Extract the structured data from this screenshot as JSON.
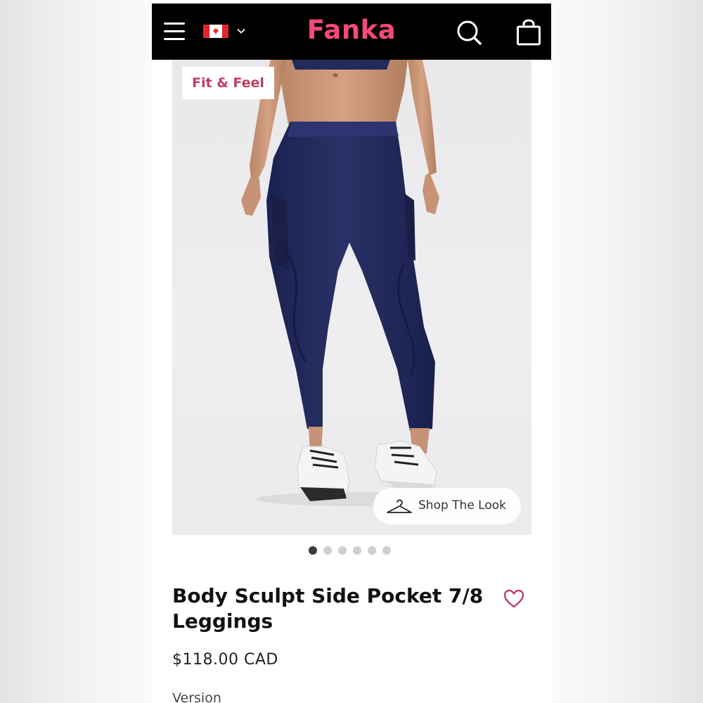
{
  "header": {
    "brand": "Fanka",
    "menu_icon": "hamburger-menu-icon",
    "country_flag": "canada-flag-icon",
    "country_chevron": "chevron-down-icon",
    "search_icon": "search-icon",
    "bag_icon": "shopping-bag-icon",
    "brand_color": "#f34a78"
  },
  "gallery": {
    "badge": "Fit & Feel",
    "shop_the_look": "Shop The Look",
    "shop_icon": "hanger-icon",
    "slides": 6,
    "active_slide": 1
  },
  "product": {
    "title": "Body Sculpt Side Pocket 7/8 Leggings",
    "price": "$118.00 CAD",
    "wishlist_icon": "heart-icon",
    "option_label": "Version",
    "accent_color": "#c03d63",
    "legging_color": "#232a5c"
  }
}
